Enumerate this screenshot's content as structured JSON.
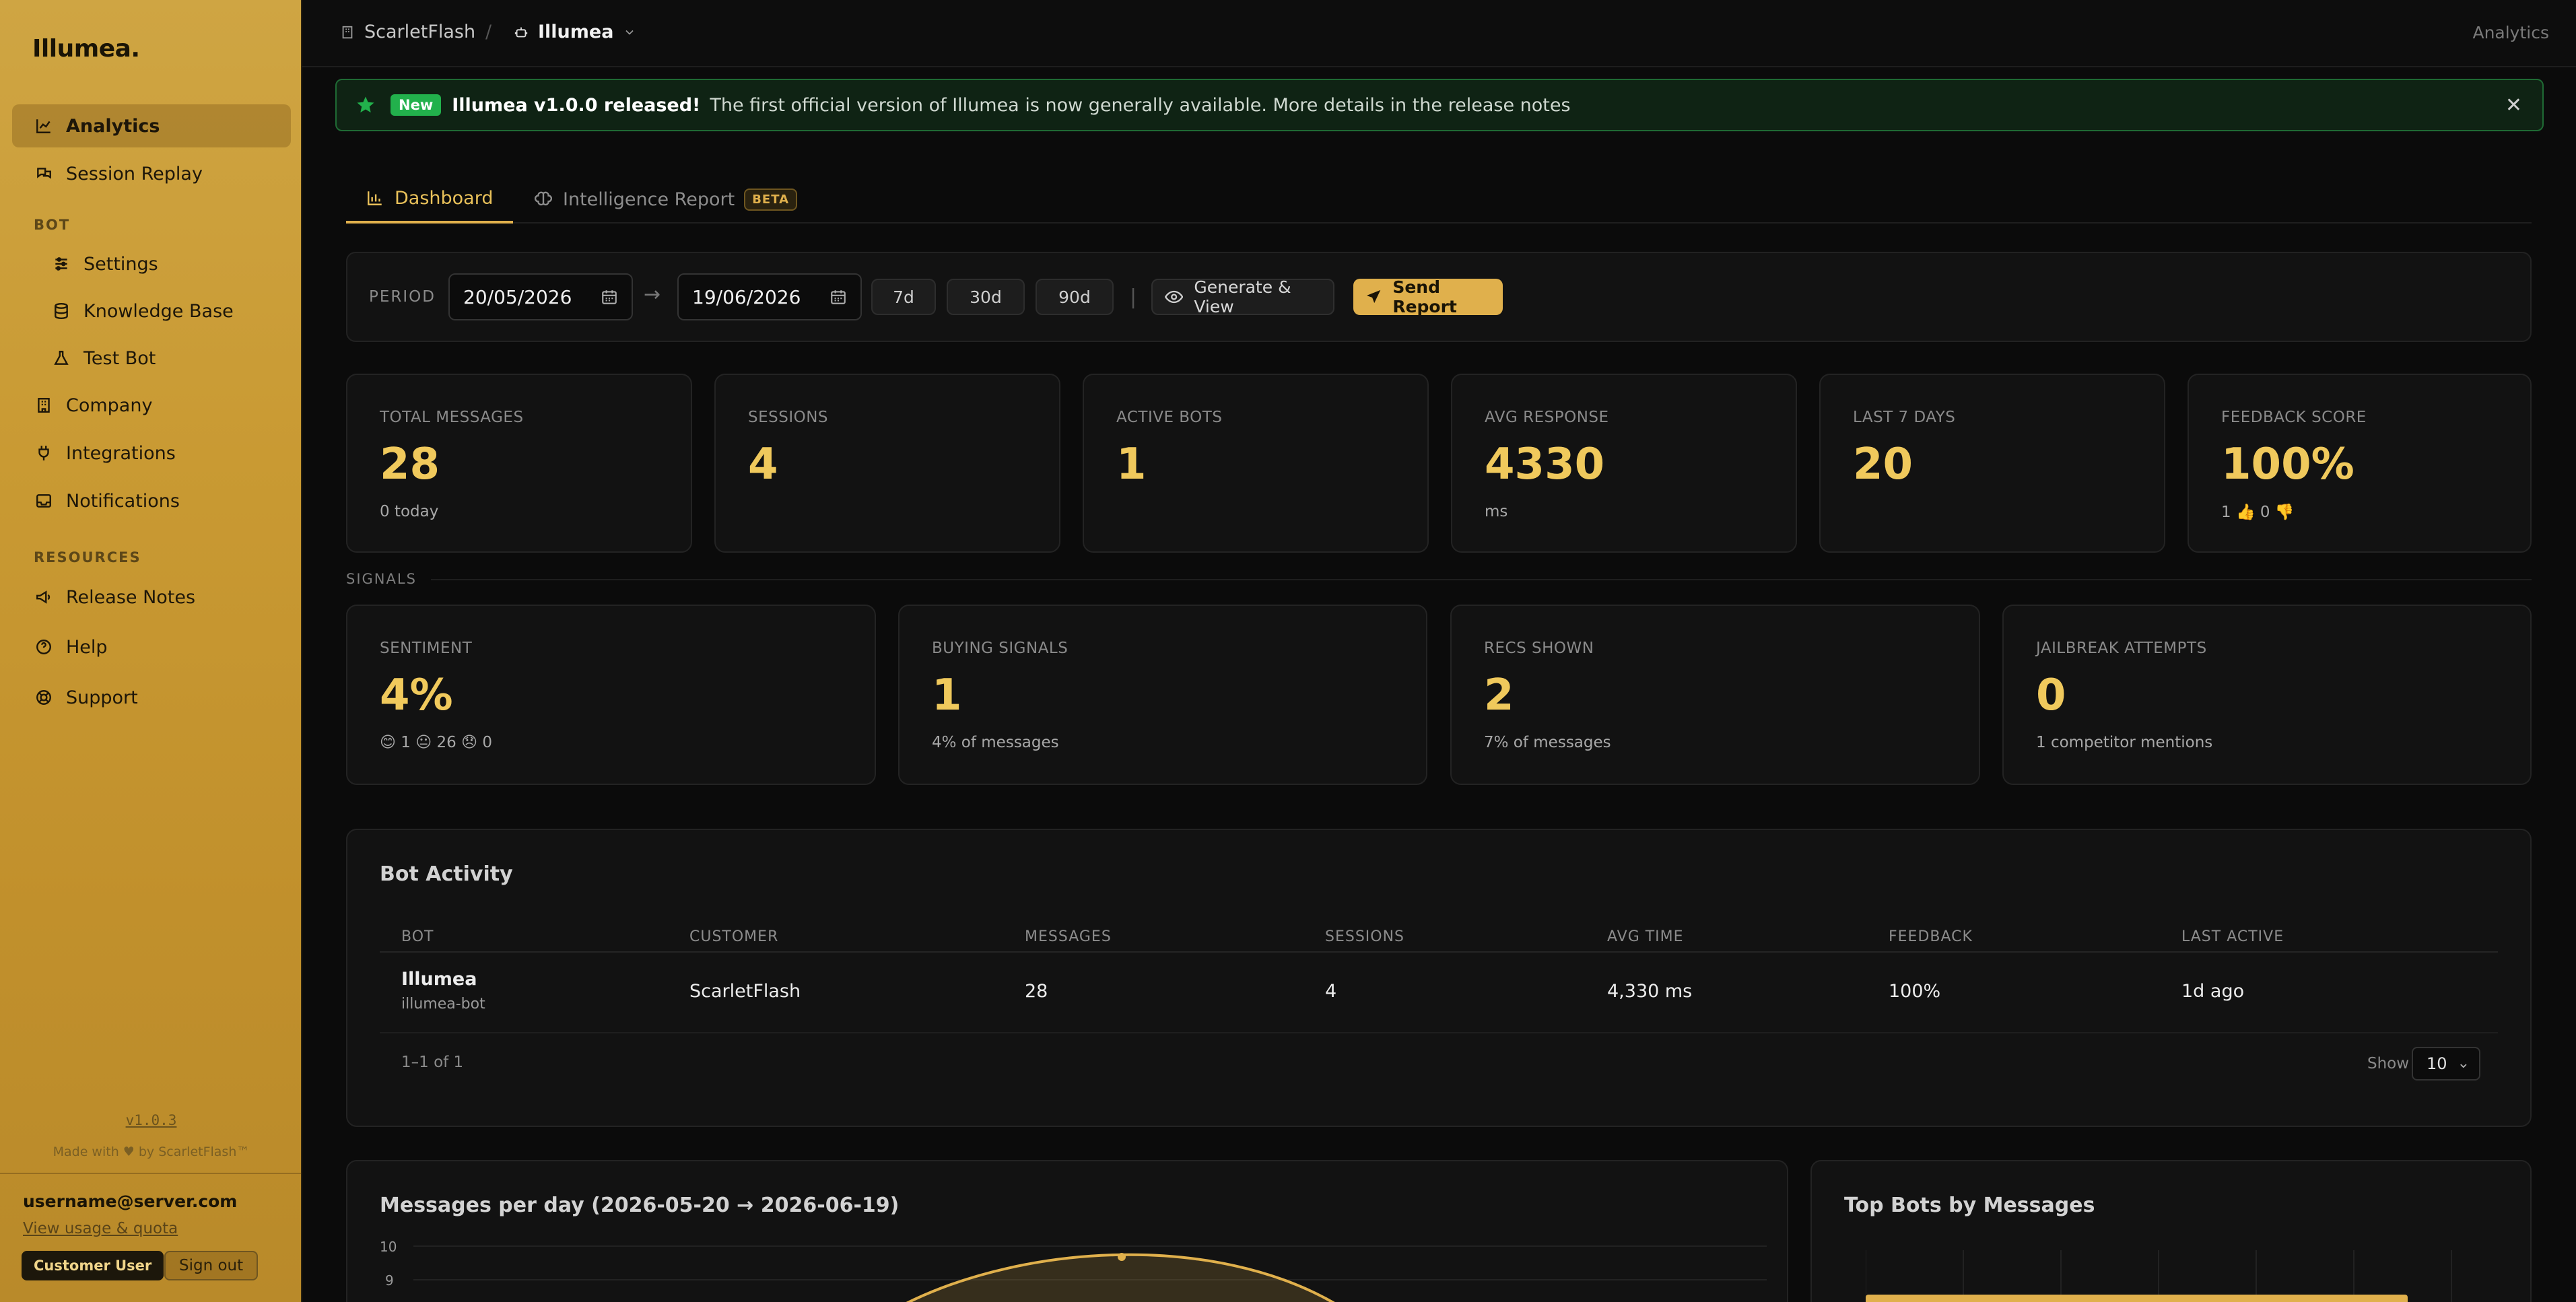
{
  "sidebar": {
    "brand": "Illumea.",
    "items": {
      "analytics": "Analytics",
      "session_replay": "Session Replay",
      "section_bot": "BOT",
      "settings": "Settings",
      "knowledge_base": "Knowledge Base",
      "test_bot": "Test Bot",
      "company": "Company",
      "integrations": "Integrations",
      "notifications": "Notifications",
      "section_resources": "RESOURCES",
      "release_notes": "Release Notes",
      "help": "Help",
      "support": "Support"
    },
    "version": "v1.0.3",
    "made_with": "Made with ♥ by ScarletFlash™",
    "user_email": "username@server.com",
    "usage_link": "View usage & quota",
    "role": "Customer User",
    "sign_out": "Sign out"
  },
  "topbar": {
    "org": "ScarletFlash",
    "separator": "/",
    "bot": "Illumea",
    "page": "Analytics"
  },
  "banner": {
    "badge": "New",
    "title": "Illumea v1.0.0 released!",
    "text": "The first official version of Illumea is now generally available. More details in the release notes",
    "close": "✕"
  },
  "tabs": {
    "dashboard": "Dashboard",
    "intelligence": "Intelligence Report",
    "beta": "BETA"
  },
  "period": {
    "label": "PERIOD",
    "from": "20/05/2026",
    "to": "19/06/2026",
    "arrow": "→",
    "chips": [
      "7d",
      "30d",
      "90d"
    ],
    "separator": "|",
    "generate": "Generate & View",
    "send": "Send Report"
  },
  "stats": [
    {
      "label": "TOTAL MESSAGES",
      "value": "28",
      "sub": "0 today"
    },
    {
      "label": "SESSIONS",
      "value": "4",
      "sub": ""
    },
    {
      "label": "ACTIVE BOTS",
      "value": "1",
      "sub": ""
    },
    {
      "label": "AVG RESPONSE",
      "value": "4330",
      "sub": "ms"
    },
    {
      "label": "LAST 7 DAYS",
      "value": "20",
      "sub": ""
    },
    {
      "label": "FEEDBACK SCORE",
      "value": "100%",
      "sub": "1 👍 0 👎"
    }
  ],
  "signals_label": "SIGNALS",
  "signals": [
    {
      "label": "SENTIMENT",
      "value": "4%",
      "sub": "😊 1 😐 26 😞 0"
    },
    {
      "label": "BUYING SIGNALS",
      "value": "1",
      "sub": "4% of messages"
    },
    {
      "label": "RECS SHOWN",
      "value": "2",
      "sub": "7% of messages"
    },
    {
      "label": "JAILBREAK ATTEMPTS",
      "value": "0",
      "sub": "1 competitor mentions"
    }
  ],
  "bot_activity": {
    "title": "Bot Activity",
    "columns": [
      "BOT",
      "CUSTOMER",
      "MESSAGES",
      "SESSIONS",
      "AVG TIME",
      "FEEDBACK",
      "LAST ACTIVE"
    ],
    "rows": [
      {
        "bot": "Illumea",
        "bot_id": "illumea-bot",
        "customer": "ScarletFlash",
        "messages": "28",
        "sessions": "4",
        "avg_time": "4,330 ms",
        "feedback": "100%",
        "last_active": "1d ago"
      }
    ],
    "pager": "1–1 of 1",
    "show_label": "Show",
    "page_size": "10"
  },
  "messages_chart": {
    "title": "Messages per day (2026-05-20 → 2026-06-19)",
    "y_ticks": [
      "10",
      "9"
    ]
  },
  "top_bots_chart": {
    "title": "Top Bots by Messages"
  },
  "chart_data": [
    {
      "type": "area",
      "title": "Messages per day (2026-05-20 → 2026-06-19)",
      "xlabel": "",
      "ylabel": "",
      "y_ticks": [
        10,
        9
      ],
      "note": "only the top portion of the chart is visible; curve peaks at about 10"
    },
    {
      "type": "bar",
      "title": "Top Bots by Messages",
      "note": "only the top edge of the chart is visible"
    }
  ],
  "colors": {
    "accent": "#e0b04c",
    "value": "#f0c95c",
    "success": "#22b14c"
  }
}
